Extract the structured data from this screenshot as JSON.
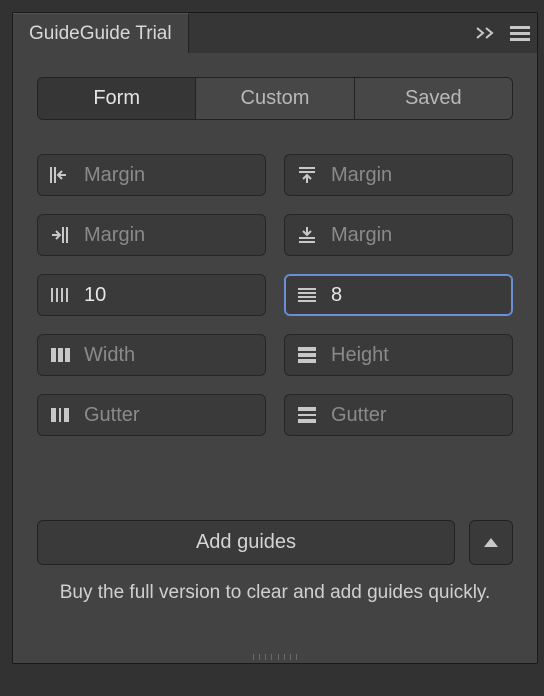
{
  "header": {
    "title": "GuideGuide Trial"
  },
  "tabs": {
    "form": "Form",
    "custom": "Custom",
    "saved": "Saved"
  },
  "fields": {
    "margin_left": {
      "placeholder": "Margin",
      "value": ""
    },
    "margin_top": {
      "placeholder": "Margin",
      "value": ""
    },
    "margin_right": {
      "placeholder": "Margin",
      "value": ""
    },
    "margin_bottom": {
      "placeholder": "Margin",
      "value": ""
    },
    "columns": {
      "placeholder": "",
      "value": "10"
    },
    "rows": {
      "placeholder": "",
      "value": "8"
    },
    "width": {
      "placeholder": "Width",
      "value": ""
    },
    "height": {
      "placeholder": "Height",
      "value": ""
    },
    "column_gutter": {
      "placeholder": "Gutter",
      "value": ""
    },
    "row_gutter": {
      "placeholder": "Gutter",
      "value": ""
    }
  },
  "buttons": {
    "add_guides": "Add guides"
  },
  "messages": {
    "trial": "Buy the full version to clear and add guides quickly."
  }
}
